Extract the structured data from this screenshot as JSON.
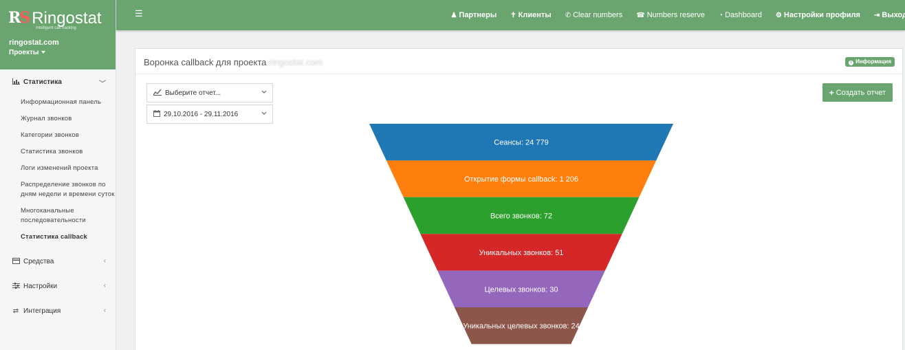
{
  "brand": {
    "name": "Ringostat",
    "tagline": "intelligent call tracking",
    "account": "ringostat.com",
    "projects_label": "Проекты"
  },
  "sidebar": {
    "sections": [
      {
        "label": "Статистика",
        "icon": "bar-chart-icon",
        "glyph": "📊",
        "arrow": "﹀"
      },
      {
        "label": "Средства",
        "icon": "credit-card-icon",
        "glyph": "▭",
        "arrow": "‹"
      },
      {
        "label": "Настройки",
        "icon": "sliders-icon",
        "glyph": "☰",
        "arrow": "‹"
      },
      {
        "label": "Интеграция",
        "icon": "exchange-icon",
        "glyph": "⇄",
        "arrow": "‹"
      }
    ],
    "items": [
      "Информационная панель",
      "Журнал звонков",
      "Категории звонков",
      "Статистика звонков",
      "Логи изменений проекта",
      "Распределение звонков по дням недели и времени суток",
      "Многоканальные последовательности",
      "Статистика callback"
    ]
  },
  "topbar": {
    "menu_glyph": "☰",
    "nav": [
      {
        "label": "Партнеры",
        "icon": "male-icon",
        "glyph": "♟"
      },
      {
        "label": "Клиенты",
        "icon": "user-icon",
        "glyph": "✝"
      },
      {
        "label": "Clear numbers",
        "icon": "phone-icon",
        "glyph": "✆"
      },
      {
        "label": "Numbers reserve",
        "icon": "phone-square-icon",
        "glyph": "☎"
      },
      {
        "label": "Dashboard",
        "icon": "dashboard-icon",
        "glyph": "◔"
      },
      {
        "label": "Настройки профиля",
        "icon": "cogs-icon",
        "glyph": "⚙"
      },
      {
        "label": "Выход",
        "icon": "sign-out-icon",
        "glyph": "⇥"
      }
    ]
  },
  "panel": {
    "title": "Воронка callback для проекта",
    "project": "ringostat.com",
    "info_badge": "Информация",
    "report_placeholder": "Выберите отчет...",
    "date_range": "29.10.2016 - 29.11.2016",
    "create_button": "Создать отчет"
  },
  "colors": {
    "accent": "#6aa56f"
  },
  "chart_data": {
    "type": "funnel",
    "stages": [
      {
        "label": "Сеансы: 24 779",
        "value": 24779,
        "color": "#1f77b4"
      },
      {
        "label": "Открытие формы callback: 1 206",
        "value": 1206,
        "color": "#ff7f0e"
      },
      {
        "label": "Всего звонков: 72",
        "value": 72,
        "color": "#2ca02c"
      },
      {
        "label": "Уникальных звонков: 51",
        "value": 51,
        "color": "#d62728"
      },
      {
        "label": "Целевых звонков: 30",
        "value": 30,
        "color": "#9467bd"
      },
      {
        "label": "Уникальных целевых звонков: 24",
        "value": 24,
        "color": "#8c564b"
      }
    ]
  }
}
